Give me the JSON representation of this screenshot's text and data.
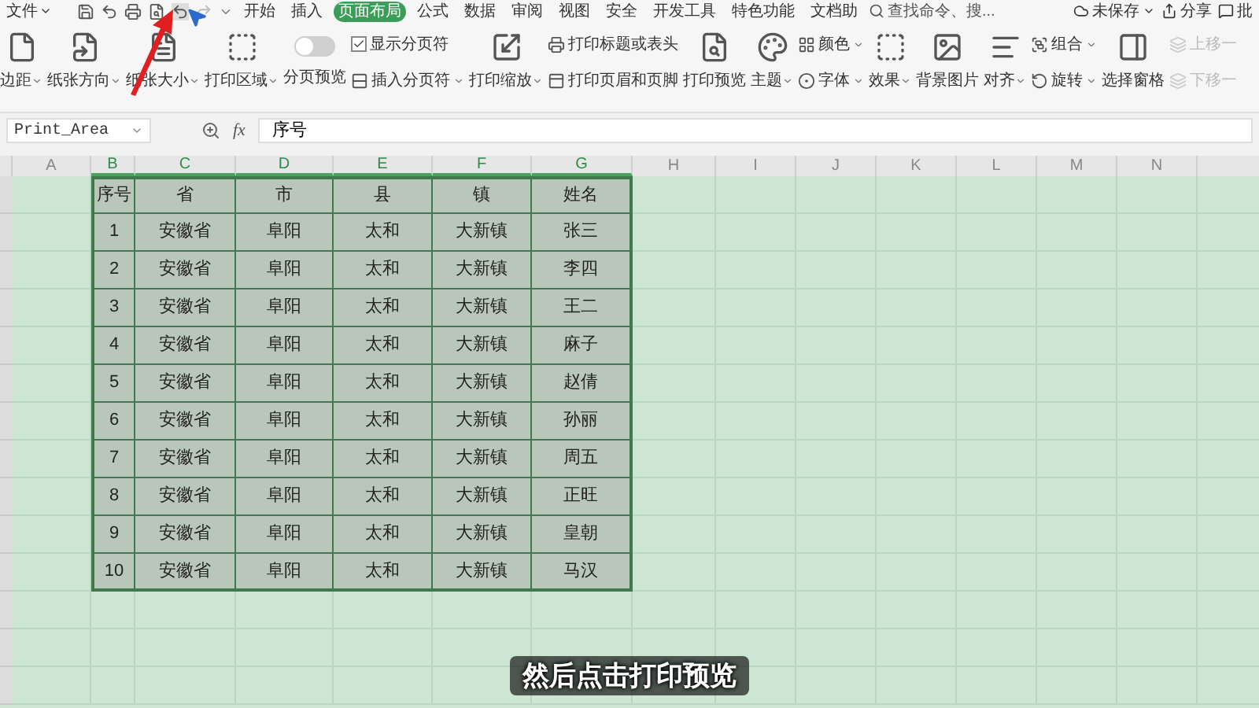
{
  "menu": {
    "file": "文件",
    "tabs": [
      {
        "label": "开始",
        "selected": false
      },
      {
        "label": "插入",
        "selected": false
      },
      {
        "label": "页面布局",
        "selected": true
      },
      {
        "label": "公式",
        "selected": false
      },
      {
        "label": "数据",
        "selected": false
      },
      {
        "label": "审阅",
        "selected": false
      },
      {
        "label": "视图",
        "selected": false
      },
      {
        "label": "安全",
        "selected": false
      },
      {
        "label": "开发工具",
        "selected": false
      },
      {
        "label": "特色功能",
        "selected": false
      },
      {
        "label": "文档助",
        "selected": false
      }
    ],
    "search": "查找命令、搜...",
    "unsaved": "未保存",
    "share": "分享",
    "comment": "批"
  },
  "ribbon": [
    {
      "kind": "large",
      "label": "边距",
      "dropdown": true
    },
    {
      "kind": "large",
      "label": "纸张方向",
      "dropdown": true
    },
    {
      "kind": "large",
      "label": "纸张大小",
      "dropdown": true
    },
    {
      "kind": "large",
      "label": "打印区域",
      "dropdown": true
    },
    {
      "kind": "toggle",
      "label": "分页预览",
      "on": false
    },
    {
      "kind": "stack",
      "items": [
        {
          "label": "显示分页符",
          "checked": true,
          "dropdown": false,
          "disabled": false
        },
        {
          "label": "插入分页符",
          "dropdown": true,
          "disabled": false
        }
      ]
    },
    {
      "kind": "large",
      "label": "打印缩放",
      "dropdown": true
    },
    {
      "kind": "stack",
      "items": [
        {
          "label": "打印标题或表头",
          "dropdown": false,
          "disabled": false
        },
        {
          "label": "打印页眉和页脚",
          "dropdown": false,
          "disabled": false
        }
      ]
    },
    {
      "kind": "large",
      "label": "打印预览",
      "dropdown": false
    },
    {
      "kind": "large",
      "label": "主题",
      "dropdown": true
    },
    {
      "kind": "stack",
      "items": [
        {
          "label": "颜色",
          "dropdown": true,
          "disabled": false
        },
        {
          "label": "字体",
          "dropdown": true,
          "disabled": false
        }
      ]
    },
    {
      "kind": "large",
      "label": "效果",
      "dropdown": true
    },
    {
      "kind": "large",
      "label": "背景图片",
      "dropdown": false
    },
    {
      "kind": "large",
      "label": "对齐",
      "dropdown": true
    },
    {
      "kind": "stack",
      "items": [
        {
          "label": "组合",
          "dropdown": true,
          "disabled": false
        },
        {
          "label": "旋转",
          "dropdown": true,
          "disabled": false
        }
      ]
    },
    {
      "kind": "large",
      "label": "选择窗格",
      "dropdown": false
    },
    {
      "kind": "stack",
      "items": [
        {
          "label": "上移一",
          "dropdown": false,
          "disabled": true
        },
        {
          "label": "下移一",
          "dropdown": false,
          "disabled": true
        }
      ]
    }
  ],
  "formula_bar": {
    "name_box": "Print_Area",
    "fx": "fx",
    "value": "序号"
  },
  "sheet": {
    "columns": [
      "A",
      "B",
      "C",
      "D",
      "E",
      "F",
      "G",
      "H",
      "I",
      "J",
      "K",
      "L",
      "M",
      "N"
    ],
    "rows": [
      [
        "",
        "序号",
        "省",
        "市",
        "县",
        "镇",
        "姓名"
      ],
      [
        "",
        "1",
        "安徽省",
        "阜阳",
        "太和",
        "大新镇",
        "张三"
      ],
      [
        "",
        "2",
        "安徽省",
        "阜阳",
        "太和",
        "大新镇",
        "李四"
      ],
      [
        "",
        "3",
        "安徽省",
        "阜阳",
        "太和",
        "大新镇",
        "王二"
      ],
      [
        "",
        "4",
        "安徽省",
        "阜阳",
        "太和",
        "大新镇",
        "麻子"
      ],
      [
        "",
        "5",
        "安徽省",
        "阜阳",
        "太和",
        "大新镇",
        "赵倩"
      ],
      [
        "",
        "6",
        "安徽省",
        "阜阳",
        "太和",
        "大新镇",
        "孙丽"
      ],
      [
        "",
        "7",
        "安徽省",
        "阜阳",
        "太和",
        "大新镇",
        "周五"
      ],
      [
        "",
        "8",
        "安徽省",
        "阜阳",
        "太和",
        "大新镇",
        "正旺"
      ],
      [
        "",
        "9",
        "安徽省",
        "阜阳",
        "太和",
        "大新镇",
        "皇朝"
      ],
      [
        "",
        "10",
        "安徽省",
        "阜阳",
        "太和",
        "大新镇",
        "马汉"
      ]
    ]
  },
  "subtitle": "然后点击打印预览"
}
